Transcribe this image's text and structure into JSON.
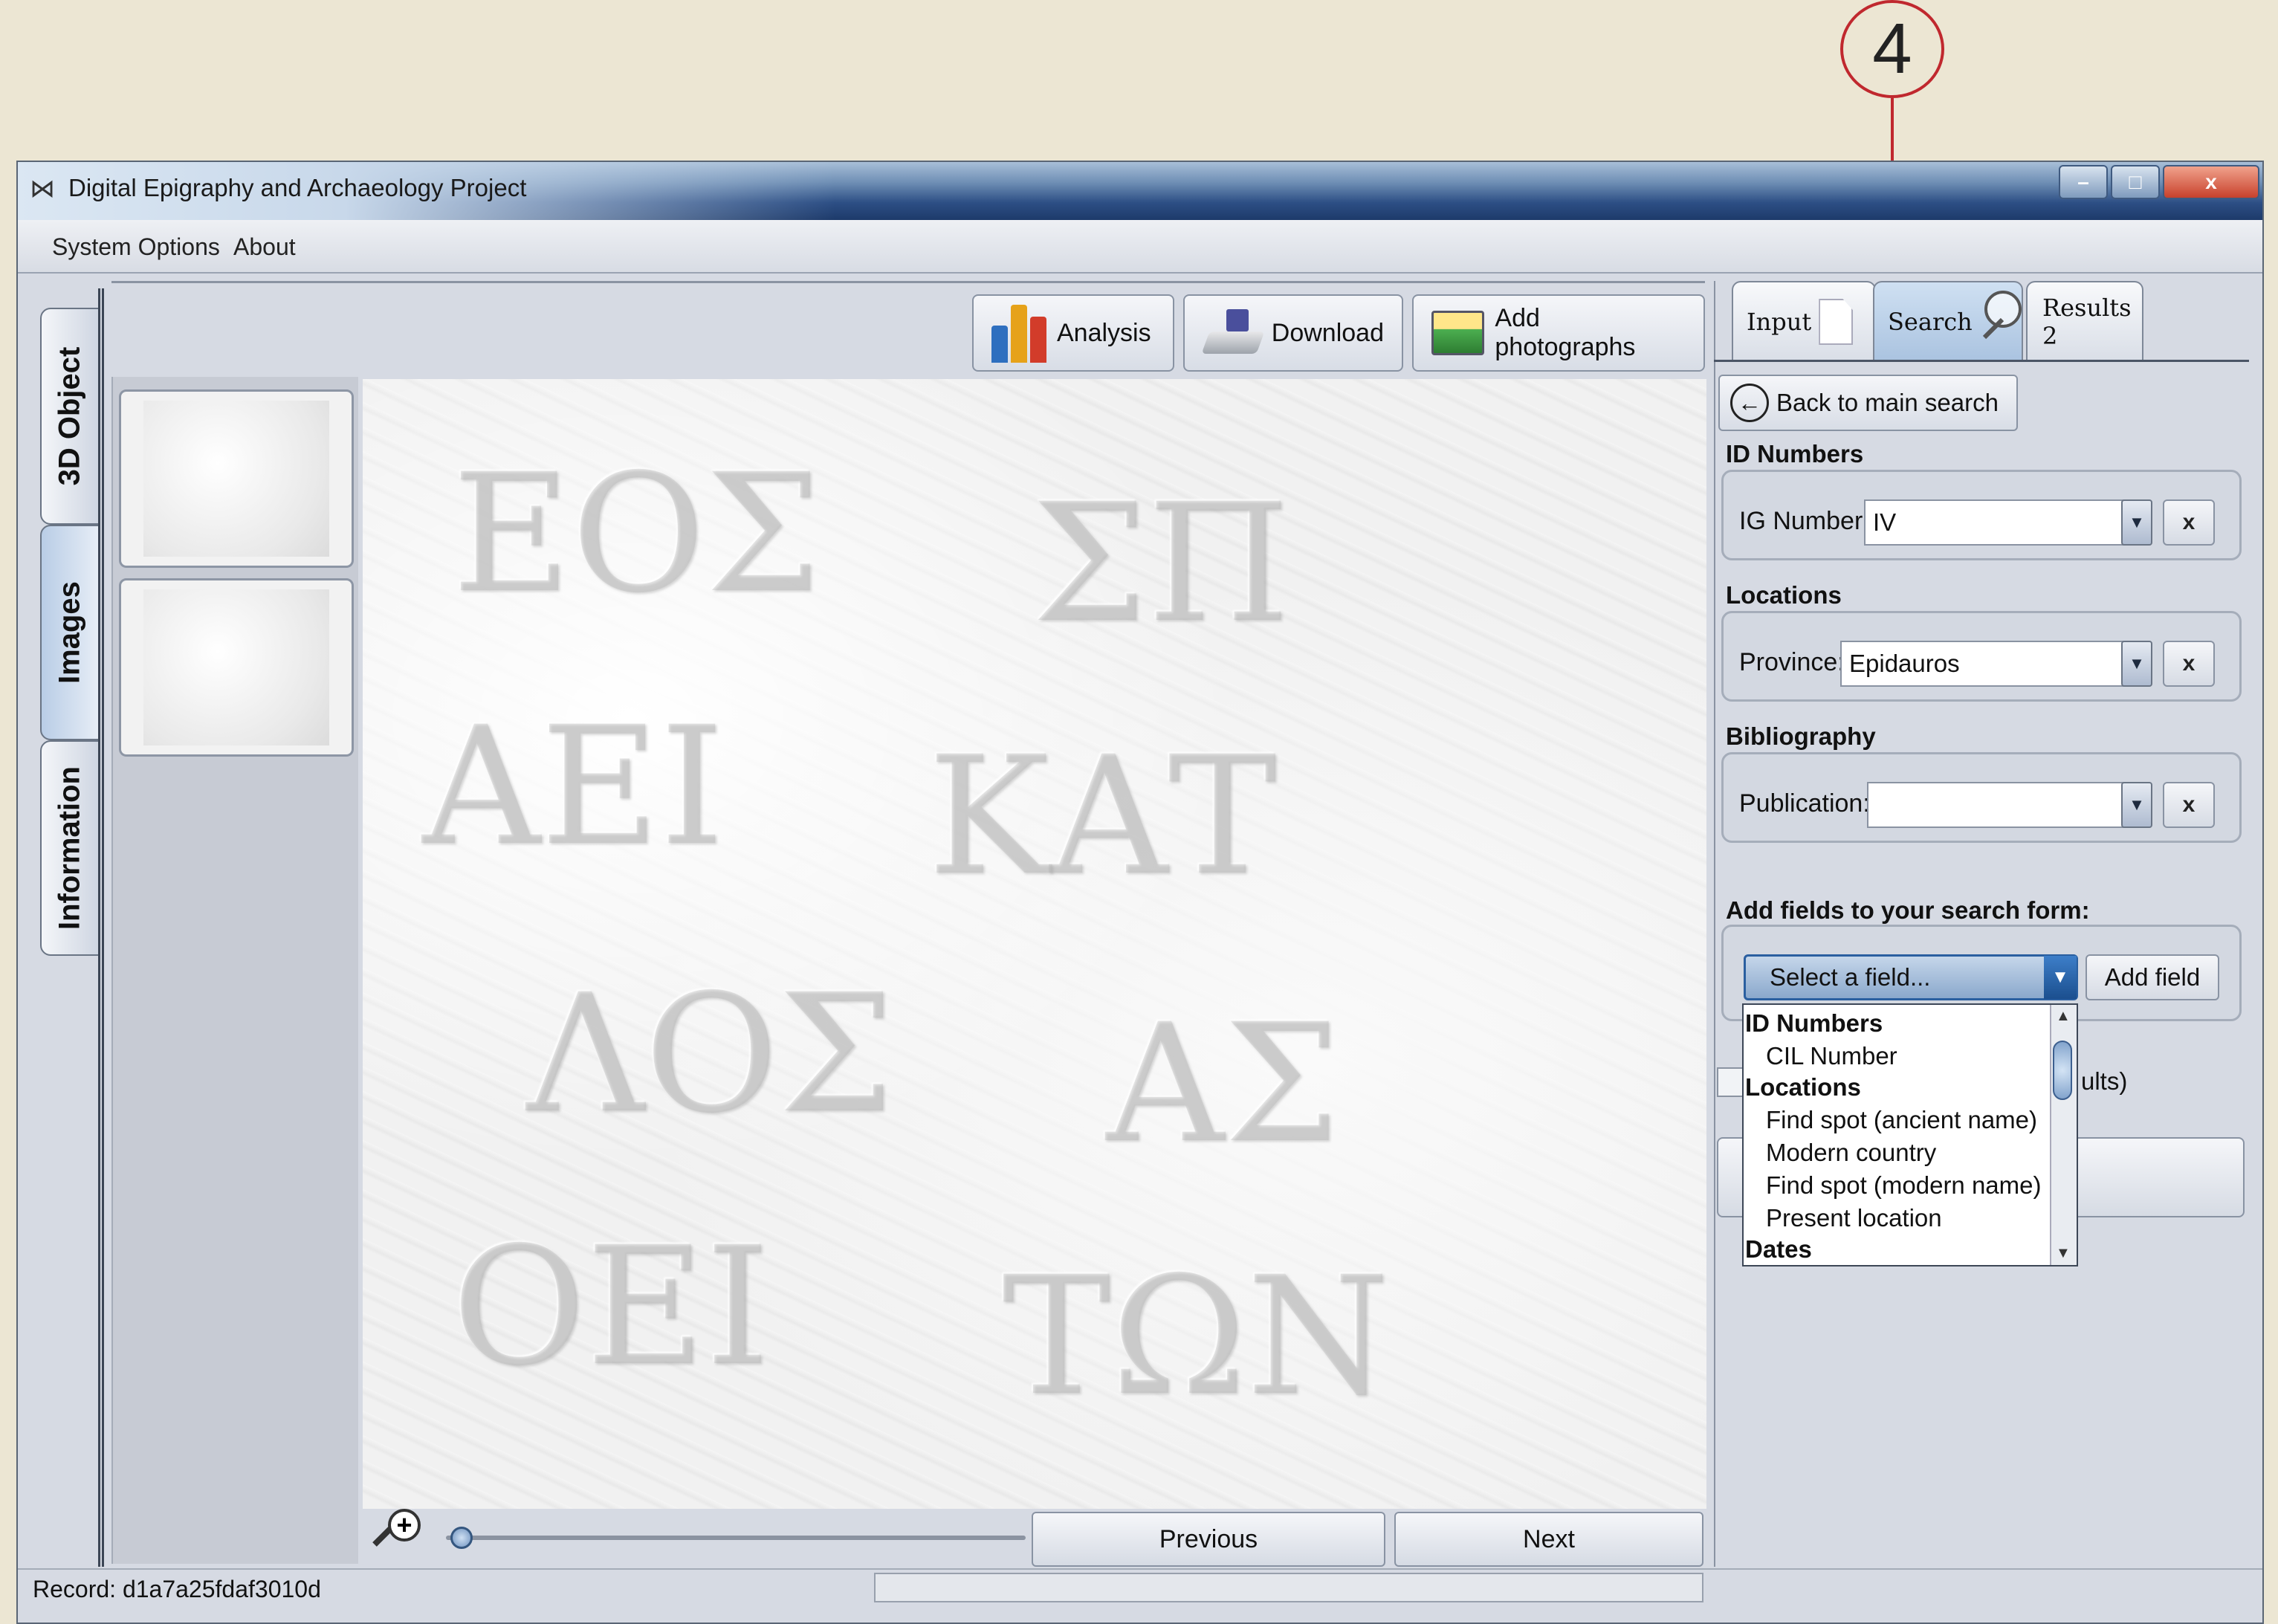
{
  "annotation": {
    "step_number": "4"
  },
  "window": {
    "title": "Digital Epigraphy and Archaeology Project",
    "minimize": "–",
    "maximize": "□",
    "close": "x"
  },
  "menu": {
    "items": [
      "System Options",
      "About"
    ]
  },
  "side_tabs": [
    {
      "label": "3D Object"
    },
    {
      "label": "Images"
    },
    {
      "label": "Information"
    }
  ],
  "toolbar": {
    "analysis": "Analysis",
    "download": "Download",
    "add_photographs": "Add photographs"
  },
  "viewer": {
    "previous": "Previous",
    "next": "Next",
    "zoom_value": 0.02
  },
  "status": {
    "record": "Record: d1a7a25fdaf3010d"
  },
  "right_tabs": [
    {
      "label": "Input"
    },
    {
      "label": "Search"
    },
    {
      "label": "Results 2"
    }
  ],
  "search_form": {
    "back_label": "Back to main search",
    "sections": [
      {
        "title": "ID Numbers",
        "field_label": "IG Number:",
        "value": "IV"
      },
      {
        "title": "Locations",
        "field_label": "Province:",
        "value": "Epidauros"
      },
      {
        "title": "Bibliography",
        "field_label": "Publication:",
        "value": ""
      }
    ],
    "clear_label": "x",
    "add_fields_title": "Add fields to your search form:",
    "select_placeholder": "Select a field...",
    "add_field_button": "Add field",
    "partial_checkbox_suffix": "ults)"
  },
  "dropdown_items": [
    {
      "label": "ID Numbers",
      "kind": "head"
    },
    {
      "label": "CIL Number",
      "kind": "sub"
    },
    {
      "label": "Locations",
      "kind": "head"
    },
    {
      "label": "Find spot (ancient name)",
      "kind": "sub"
    },
    {
      "label": "Modern country",
      "kind": "sub"
    },
    {
      "label": "Find spot (modern name)",
      "kind": "sub"
    },
    {
      "label": "Present location",
      "kind": "sub"
    },
    {
      "label": "Dates",
      "kind": "head"
    }
  ],
  "colors": {
    "annotation_red": "#c0282e",
    "selection_blue": "#2a5fa0"
  }
}
